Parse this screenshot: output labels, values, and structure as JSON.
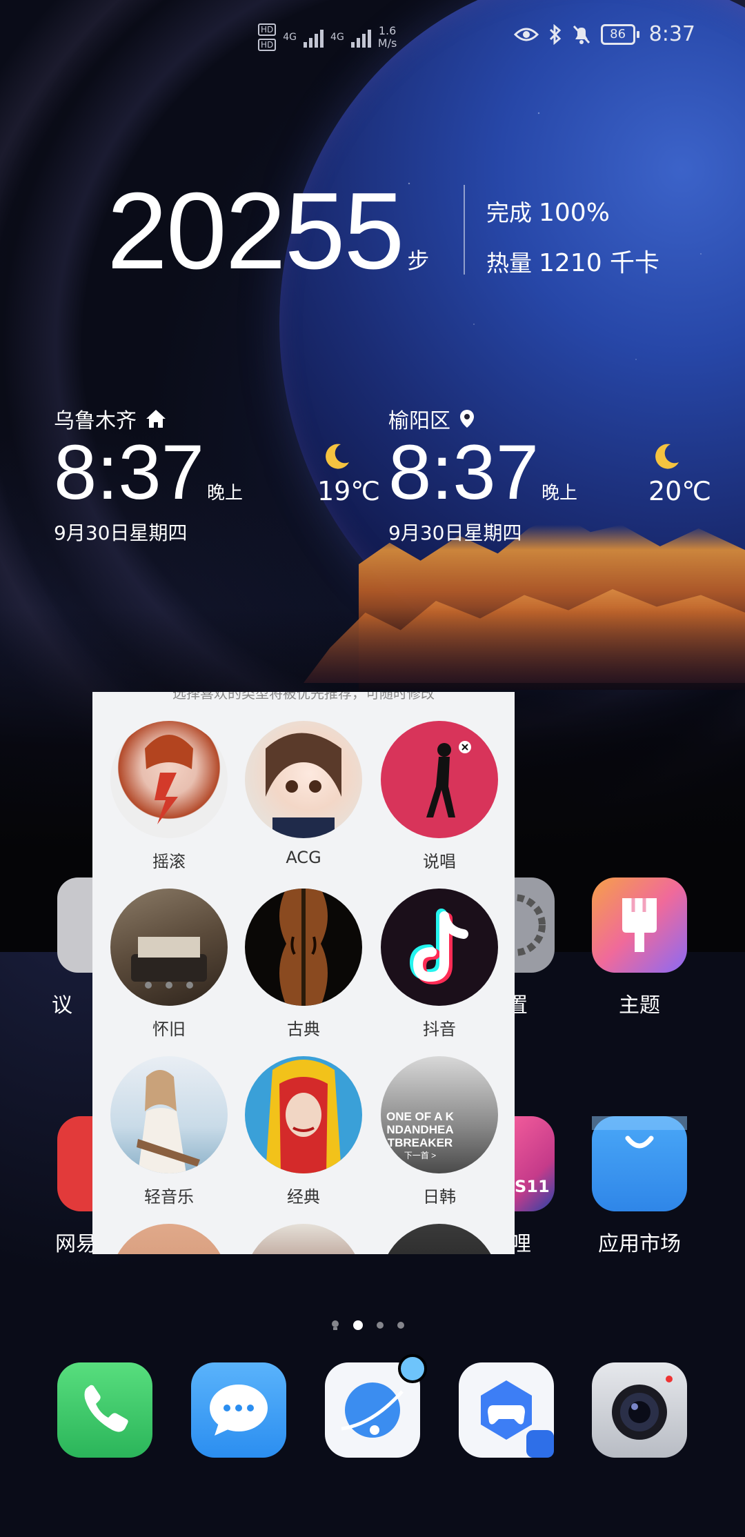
{
  "status_bar": {
    "hd1": "HD",
    "hd2": "HD",
    "net1": "4G",
    "net2": "4G",
    "speed_value": "1.6",
    "speed_unit": "M/s",
    "battery": "86",
    "time": "8:37"
  },
  "health": {
    "steps": "20255",
    "steps_unit": "步",
    "complete_label": "完成",
    "complete_value": "100%",
    "calories_label": "热量",
    "calories_value": "1210 千卡"
  },
  "clocks": [
    {
      "city": "乌鲁木齐",
      "time": "8:37",
      "ampm": "晚上",
      "date": "9月30日星期四",
      "temp": "19℃"
    },
    {
      "city": "榆阳区",
      "time": "8:37",
      "ampm": "晚上",
      "date": "9月30日星期四",
      "temp": "20℃"
    }
  ],
  "home_apps": {
    "row1_left_label": "议",
    "row1_settings_label": "置",
    "row1_theme_label": "主题",
    "row2_left_label": "网易",
    "row2_bili_label": "哔哩",
    "row2_bili_badge": "S11",
    "row2_market_label": "应用市场"
  },
  "panel": {
    "hint": "选择喜欢的类型将被优先推荐，可随时修改",
    "genres": [
      "摇滚",
      "ACG",
      "说唱",
      "怀旧",
      "古典",
      "抖音",
      "轻音乐",
      "经典",
      "日韩"
    ],
    "rihan_poster_lines": [
      "ONE OF A K",
      "NDANDHEA",
      "TBREAKER",
      "下一首 >"
    ]
  },
  "colors": {
    "panel_bg": "#f2f3f5",
    "dock_phone": "#3ccf6a",
    "dock_message": "#3b9af5",
    "theme_icon": "#f06a9a",
    "market_icon": "#3d9af3"
  },
  "dock": [
    "phone-icon",
    "message-icon",
    "browser-icon",
    "game-center-icon",
    "camera-icon"
  ]
}
